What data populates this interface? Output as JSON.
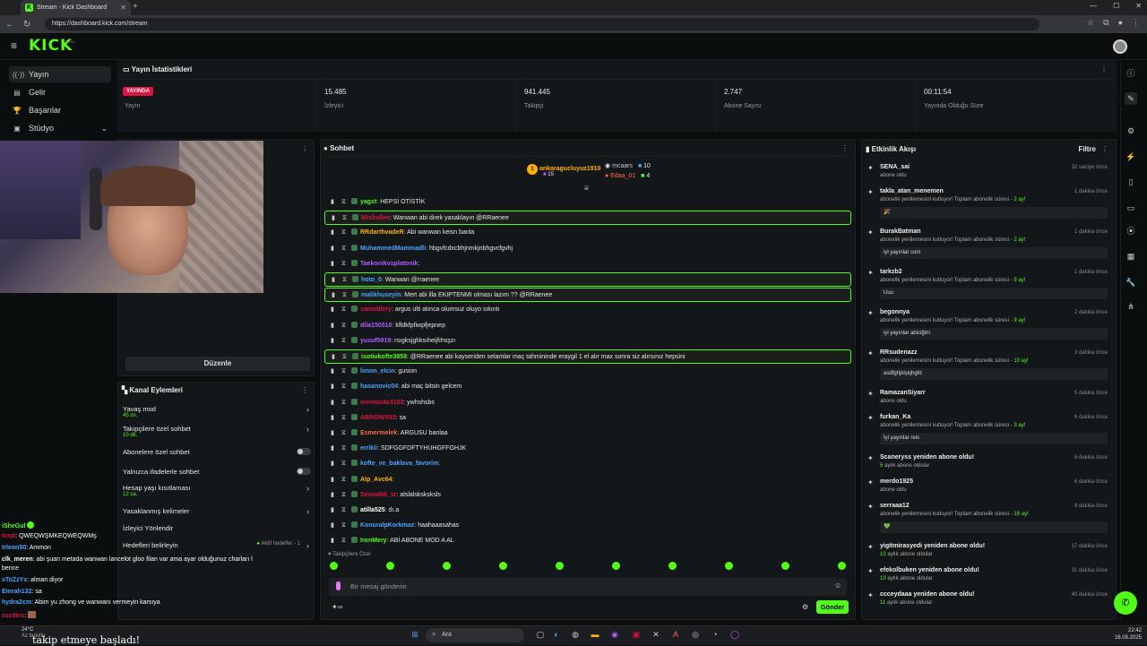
{
  "browser": {
    "tab_title": "Stream - Kick Dashboard",
    "url": "https://dashboard.kick.com/stream"
  },
  "header": {
    "logo": "KICK",
    "logo_badge": "BETA"
  },
  "nav": [
    {
      "label": "Yayın",
      "icon": "broadcast-icon"
    },
    {
      "label": "Gelir",
      "icon": "revenue-icon"
    },
    {
      "label": "Başarılar",
      "icon": "trophy-icon"
    },
    {
      "label": "Stüdyo",
      "icon": "studio-icon"
    }
  ],
  "stats": {
    "title": "Yayın İstatistikleri",
    "live_badge": "YAYINDA",
    "items": [
      {
        "value": "",
        "label": "Yayın"
      },
      {
        "value": "15.485",
        "label": "İzleyici"
      },
      {
        "value": "941.445",
        "label": "Takipçi"
      },
      {
        "value": "2.747",
        "label": "Abone Sayısı"
      },
      {
        "value": "00:11:54",
        "label": "Yayında Olduğu Süre"
      }
    ]
  },
  "video": {
    "edit_label": "Düzenle"
  },
  "actions": {
    "title": "Kanal Eylemleri",
    "rows": [
      {
        "label": "Yavaş mod",
        "sub": "45 sn.",
        "control": "chevron"
      },
      {
        "label": "Takipçilere özel sohbet",
        "sub": "10 dk.",
        "control": "chevron"
      },
      {
        "label": "Abonelere özel sohbet",
        "sub": "",
        "control": "toggle"
      },
      {
        "label": "Yalnızca ifadelerle sohbet",
        "sub": "",
        "control": "toggle"
      },
      {
        "label": "Hesap yaşı kısıtlaması",
        "sub": "12 sa.",
        "control": "chevron"
      },
      {
        "label": "Yasaklanmış kelimeler",
        "sub": "",
        "control": "chevron"
      },
      {
        "label": "İzleyici Yönlendir",
        "sub": "",
        "control": "none"
      },
      {
        "label": "Hedefleri belirleyin",
        "sub": "",
        "control": "chevron",
        "extra": "Aktif hedefler - 1"
      }
    ]
  },
  "overlay_chat": [
    {
      "name": "iSheGul",
      "text": "",
      "color": "#53fc18"
    },
    {
      "name": "tcrpl",
      "text": "QWEQWŞMKEQWEQWMş",
      "color": "#e0123f"
    },
    {
      "name": "trleon50",
      "text": "Ammon",
      "color": "#4aa3ff"
    },
    {
      "name": "clk_meren",
      "text": "abi şuan metada wanwan lancelot gloo filan var ama ayar olduğunuz charları l",
      "color": "#ffffff"
    },
    {
      "name": "",
      "text": "bence",
      "color": "#ffffff"
    },
    {
      "name": "xToZzYx",
      "text": "alman diyor",
      "color": "#4aa3ff"
    },
    {
      "name": "Emrah132",
      "text": "sa",
      "color": "#4aa3ff"
    },
    {
      "name": "hydra2cm",
      "text": "Abim yu zhong ve wanwanı vermeyin karsıya",
      "color": "#4aa3ff"
    },
    {
      "name": "zuzdivs",
      "text": "",
      "color": "#e0123f"
    }
  ],
  "overlay_footer": {
    "text": "takip etmeye başladı!",
    "weather_temp": "24°C",
    "weather_desc": "Az bulutlu"
  },
  "chat": {
    "title": "Sohbet",
    "top_gifters": [
      {
        "rank": "1",
        "name": "ankaragucluyuz1910",
        "count": "15"
      },
      {
        "rank": "",
        "name": "mcaars",
        "count": "10"
      },
      {
        "rank": "",
        "name": "Edaa_01",
        "count": "4"
      }
    ],
    "messages": [
      {
        "user": "yagst",
        "text": "HEPSİ OTİSTİK",
        "color": "#53fc18",
        "hl": false
      },
      {
        "user": "Mrsksllee",
        "text": "Wanwan abi direk yasaklayın @RRaenee",
        "color": "#e0123f",
        "hl": true
      },
      {
        "user": "RRdarthvadeR",
        "text": "Abi wanwan keisn banla",
        "color": "#ffb000",
        "hl": false
      },
      {
        "user": "MuhammedMammadli",
        "text": "hbgvfcdxcbhjnmkjnbhgvcfgvhj",
        "color": "#4aa3ff",
        "hl": false
      },
      {
        "user": "Taekonikvsplatonik",
        "text": "",
        "color": "#b05cff",
        "hl": false
      },
      {
        "user": "hoto_0",
        "text": "Wanwan @rraenee",
        "color": "#4aa3ff",
        "hl": true
      },
      {
        "user": "malikhuseyin",
        "text": "Mert abi illa EKIPTENMI olması lazım ?? @RRaenee",
        "color": "#4aa3ff",
        "hl": true
      },
      {
        "user": "samotilery",
        "text": "argus ulti atınca olumsuz oluyo sıkıntı",
        "color": "#e0123f",
        "hl": false
      },
      {
        "user": "dila150510",
        "text": "kfldkfpfiwpfjepnep",
        "color": "#b05cff",
        "hl": false
      },
      {
        "user": "yusuf5919",
        "text": "rsıgksjgfıksıheijfıhsşzı",
        "color": "#b05cff",
        "hl": false
      },
      {
        "user": "isotiukofte3858",
        "text": "@RRaenee abi kayseriden selamlar maç tahmininde eraygil 1 el alır max sonra siz alırsınız hepsini",
        "color": "#53fc18",
        "hl": true
      },
      {
        "user": "limon_elcin",
        "text": "gusion",
        "color": "#4aa3ff",
        "hl": false
      },
      {
        "user": "hasanovic04",
        "text": "abi maç bitsin gelcem",
        "color": "#4aa3ff",
        "hl": false
      },
      {
        "user": "merelasta3183",
        "text": "ywhshsbs",
        "color": "#e0123f",
        "hl": false
      },
      {
        "user": "ABROWX93",
        "text": "sa",
        "color": "#e0123f",
        "hl": false
      },
      {
        "user": "Esmermelek",
        "text": "ARGUSU banlaa",
        "color": "#ff6a3d",
        "hl": false
      },
      {
        "user": "errikli",
        "text": "SDFGGFDFTYHUHGFFGHJK",
        "color": "#4aa3ff",
        "hl": false
      },
      {
        "user": "kofte_ve_baklava_favorim",
        "text": "",
        "color": "#4aa3ff",
        "hl": false
      },
      {
        "user": "Alp_Avc64",
        "text": "",
        "color": "#ffb000",
        "hl": false
      },
      {
        "user": "Sevval06_sr",
        "text": "alslalsksksksls",
        "color": "#e0123f",
        "hl": false
      },
      {
        "user": "atilla525",
        "text": "dı.a",
        "color": "#ffffff",
        "hl": false
      },
      {
        "user": "KonuralpKorkmaz",
        "text": "haahaaasahas",
        "color": "#4aa3ff",
        "hl": false
      },
      {
        "user": "IronMery",
        "text": "ABİ ABONE MOD A AL",
        "color": "#53fc18",
        "hl": false
      }
    ],
    "followers_only_label": "Takipçilere Özel",
    "input_placeholder": "Bir mesaj gönderin",
    "send_label": "Gönder"
  },
  "feed": {
    "title": "Etkinlik Akışı",
    "filter_label": "Filtre",
    "items": [
      {
        "name": "SENA_sai",
        "desc": "abone oldu",
        "months": "",
        "time": "32 saniye önce",
        "quote": ""
      },
      {
        "name": "takla_atan_menemen",
        "desc": "abonelik yenilemesini kutluyor! Toplam abonelik süresi -",
        "months": "2 ay!",
        "time": "1 dakika önce",
        "quote": "🎉"
      },
      {
        "name": "BurakBatman",
        "desc": "abonelik yenilemesini kutluyor! Toplam abonelik süresi -",
        "months": "2 ay!",
        "time": "1 dakika önce",
        "quote": "iyi yayınlar coni"
      },
      {
        "name": "tarkzb2",
        "desc": "abonelik yenilemesini kutluyor! Toplam abonelik süresi -",
        "months": "9 ay!",
        "time": "1 dakika önce",
        "quote": "Uuu"
      },
      {
        "name": "begonnya",
        "desc": "abonelik yenilemesini kutluyor! Toplam abonelik süresi -",
        "months": "9 ay!",
        "time": "2 dakika önce",
        "quote": "iyi yayınlar abiciğim"
      },
      {
        "name": "RRsudenazz",
        "desc": "abonelik yenilemesini kutluyor! Toplam abonelik süresi -",
        "months": "10 ay!",
        "time": "3 dakika önce",
        "quote": "asdfghjklşkjhgfd"
      },
      {
        "name": "RamazanSiyarr",
        "desc": "abone oldu",
        "months": "",
        "time": "5 dakika önce",
        "quote": ""
      },
      {
        "name": "furkan_Ka",
        "desc": "abonelik yenilemesini kutluyor! Toplam abonelik süresi -",
        "months": "3 ay!",
        "time": "6 dakika önce",
        "quote": "İyi yayınlar reis"
      },
      {
        "name": "Scaneryss yeniden abone oldu!",
        "desc": "aylık abone oldular",
        "months": "5",
        "time": "6 dakika önce",
        "quote": ""
      },
      {
        "name": "merdo1925",
        "desc": "abone oldu",
        "months": "",
        "time": "6 dakika önce",
        "quote": ""
      },
      {
        "name": "serraaa12",
        "desc": "abonelik yenilemesini kutluyor! Toplam abonelik süresi -",
        "months": "18 ay!",
        "time": "8 dakika önce",
        "quote": "💚"
      },
      {
        "name": "yigitmirasyedi yeniden abone oldu!",
        "desc": "aylık abone oldular",
        "months": "10",
        "time": "17 dakika önce",
        "quote": ""
      },
      {
        "name": "efekolbuken yeniden abone oldu!",
        "desc": "aylık abone oldular",
        "months": "10",
        "time": "31 dakika önce",
        "quote": ""
      },
      {
        "name": "ccceydaaa yeniden abone oldu!",
        "desc": "aylık abone oldular",
        "months": "11",
        "time": "40 dakika önce",
        "quote": ""
      }
    ]
  },
  "taskbar": {
    "search_placeholder": "Ara",
    "time": "22:42",
    "date": "16.08.2025"
  },
  "colors": {
    "accent": "#53fc18",
    "live": "#e0123f",
    "panel": "#141719",
    "bg": "#0b0e0f"
  }
}
